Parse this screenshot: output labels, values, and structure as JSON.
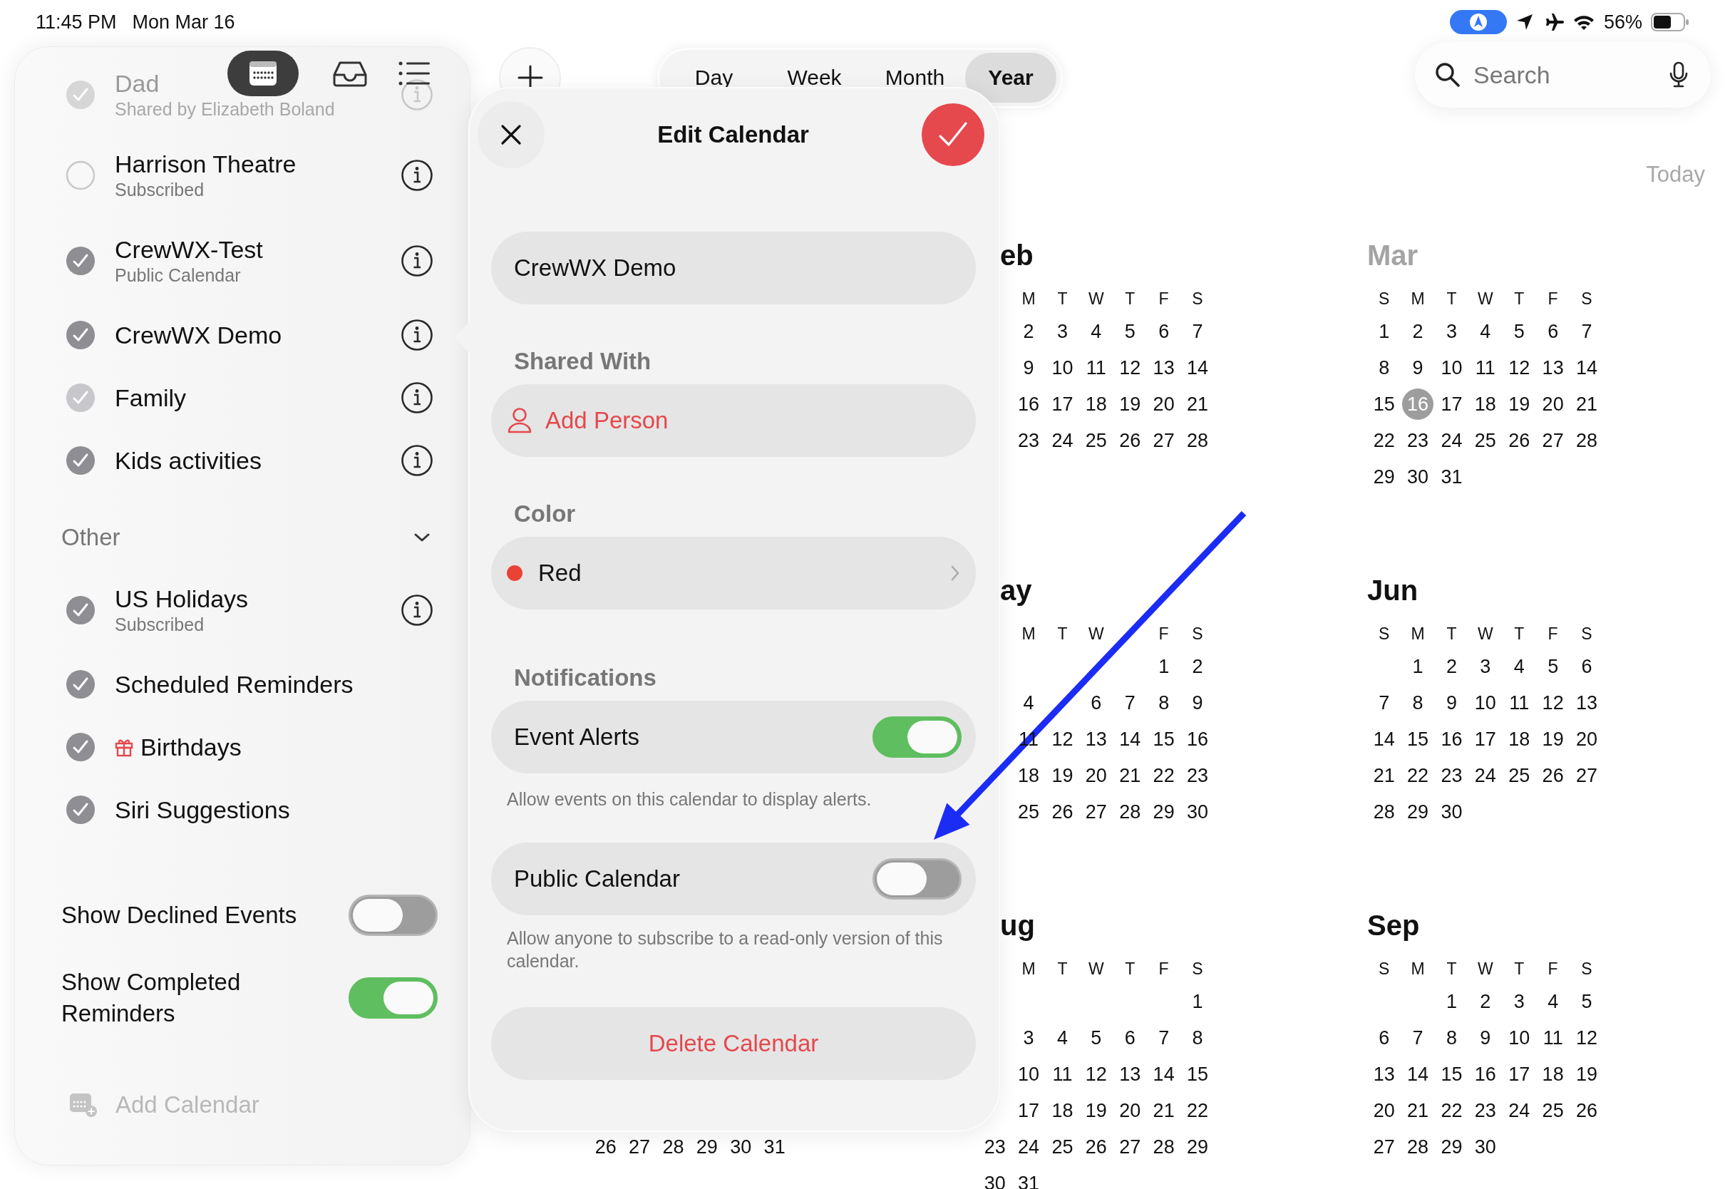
{
  "status_bar": {
    "time": "11:45 PM",
    "date": "Mon Mar 16",
    "battery": "56%"
  },
  "sidebar": {
    "toolbar": [
      {
        "kind": "calendar",
        "selected": true
      },
      {
        "kind": "inbox",
        "selected": false
      },
      {
        "kind": "list",
        "selected": false
      }
    ],
    "groups": [
      {
        "items": [
          {
            "title": "Dad",
            "subtitle": "Shared by Elizabeth Boland",
            "checked": true,
            "color": "#d6d6d6",
            "dimmed": true,
            "info": true,
            "kind": "calendar"
          },
          {
            "title": "Harrison Theatre",
            "subtitle": "Subscribed",
            "checked": false,
            "color": "#c7c7cc",
            "dimmed": false,
            "info": true,
            "kind": "calendar"
          },
          {
            "title": "CrewWX-Test",
            "subtitle": "Public Calendar",
            "checked": true,
            "color": "#8e8e93",
            "dimmed": false,
            "info": true,
            "kind": "calendar"
          },
          {
            "title": "CrewWX Demo",
            "checked": true,
            "color": "#8e8e93",
            "dimmed": false,
            "info": true,
            "kind": "calendar"
          },
          {
            "title": "Family",
            "checked": true,
            "color": "#c7c7cc",
            "dimmed": false,
            "info": true,
            "kind": "calendar"
          },
          {
            "title": "Kids activities",
            "checked": true,
            "color": "#8e8e93",
            "dimmed": false,
            "info": true,
            "kind": "calendar"
          }
        ]
      },
      {
        "header": "Other",
        "expanded": true,
        "items": [
          {
            "title": "US Holidays",
            "subtitle": "Subscribed",
            "checked": true,
            "color": "#8e8e93",
            "dimmed": false,
            "info": true,
            "kind": "calendar"
          },
          {
            "title": "Scheduled Reminders",
            "checked": true,
            "color": "#8e8e93",
            "dimmed": false,
            "info": false,
            "kind": "calendar"
          },
          {
            "title": "Birthdays",
            "checked": true,
            "color": "#8e8e93",
            "dimmed": false,
            "info": false,
            "kind": "birthday"
          },
          {
            "title": "Siri Suggestions",
            "checked": true,
            "color": "#8e8e93",
            "dimmed": false,
            "info": false,
            "kind": "calendar"
          }
        ]
      }
    ],
    "toggles": [
      {
        "label": "Show Declined Events",
        "on": false
      },
      {
        "label": "Show Completed Reminders",
        "on": true
      }
    ],
    "add_calendar": {
      "label": "Add Calendar",
      "disabled": true
    }
  },
  "view_switcher": [
    {
      "label": "Day",
      "selected": false
    },
    {
      "label": "Week",
      "selected": false
    },
    {
      "label": "Month",
      "selected": false
    },
    {
      "label": "Year",
      "selected": true
    }
  ],
  "search": {
    "placeholder": "Search"
  },
  "today_button": {
    "label": "Today",
    "disabled": true
  },
  "year_grid": {
    "rows": [
      [
        {
          "kind": "hidden"
        },
        {
          "kind": "month",
          "title": "eb",
          "current": false,
          "weekdays": {
            "mon": "M",
            "tue": "T",
            "wed": "W",
            "thu": "T",
            "fri": "F",
            "sat": "S"
          },
          "weeks": [
            {
              "mon": "2",
              "tue": "3",
              "wed": "4",
              "thu": "5",
              "fri": "6",
              "sat": "7"
            },
            {
              "mon": "9",
              "tue": "10",
              "wed": "11",
              "thu": "12",
              "fri": "13",
              "sat": "14"
            },
            {
              "mon": "16",
              "tue": "17",
              "wed": "18",
              "thu": "19",
              "fri": "20",
              "sat": "21"
            },
            {
              "mon": "23",
              "tue": "24",
              "wed": "25",
              "thu": "26",
              "fri": "27",
              "sat": "28"
            }
          ]
        },
        {
          "kind": "month",
          "title": "Mar",
          "current": true,
          "weekdays": {
            "sun": "S",
            "mon": "M",
            "tue": "T",
            "wed": "W",
            "thu": "T",
            "fri": "F",
            "sat": "S"
          },
          "weeks": [
            {
              "sun": "1",
              "mon": "2",
              "tue": "3",
              "wed": "4",
              "thu": "5",
              "fri": "6",
              "sat": "7"
            },
            {
              "sun": "8",
              "mon": "9",
              "tue": "10",
              "wed": "11",
              "thu": "12",
              "fri": "13",
              "sat": "14"
            },
            {
              "sun": "15",
              "mon": {
                "day": "16",
                "today": true
              },
              "tue": "17",
              "wed": "18",
              "thu": "19",
              "fri": "20",
              "sat": "21"
            },
            {
              "sun": "22",
              "mon": "23",
              "tue": "24",
              "wed": "25",
              "thu": "26",
              "fri": "27",
              "sat": "28"
            },
            {
              "sun": "29",
              "mon": "30",
              "tue": "31"
            }
          ]
        }
      ],
      [
        {
          "kind": "hidden"
        },
        {
          "kind": "month",
          "title": "ay",
          "current": false,
          "weekdays": {
            "mon": "M",
            "tue": "T",
            "wed": "W",
            "fri": "F",
            "sat": "S"
          },
          "weeks": [
            {
              "fri": "1",
              "sat": "2"
            },
            {
              "mon": "4",
              "wed": "6",
              "thu": "7",
              "fri": "8",
              "sat": "9"
            },
            {
              "mon": "11",
              "tue": "12",
              "wed": "13",
              "thu": "14",
              "fri": "15",
              "sat": "16"
            },
            {
              "mon": "18",
              "tue": "19",
              "wed": "20",
              "thu": "21",
              "fri": "22",
              "sat": "23"
            },
            {
              "mon": "25",
              "tue": "26",
              "wed": "27",
              "thu": "28",
              "fri": "29",
              "sat": "30"
            }
          ]
        },
        {
          "kind": "month",
          "title": "Jun",
          "current": false,
          "weekdays": {
            "sun": "S",
            "mon": "M",
            "tue": "T",
            "wed": "W",
            "thu": "T",
            "fri": "F",
            "sat": "S"
          },
          "weeks": [
            {
              "mon": "1",
              "tue": "2",
              "wed": "3",
              "thu": "4",
              "fri": "5",
              "sat": "6"
            },
            {
              "sun": "7",
              "mon": "8",
              "tue": "9",
              "wed": "10",
              "thu": "11",
              "fri": "12",
              "sat": "13"
            },
            {
              "sun": "14",
              "mon": "15",
              "tue": "16",
              "wed": "17",
              "thu": "18",
              "fri": "19",
              "sat": "20"
            },
            {
              "sun": "21",
              "mon": "22",
              "tue": "23",
              "wed": "24",
              "thu": "25",
              "fri": "26",
              "sat": "27"
            },
            {
              "sun": "28",
              "mon": "29",
              "tue": "30"
            }
          ]
        }
      ],
      [
        {
          "kind": "tail",
          "weeks": [
            {
              "sun": "26",
              "mon": "27",
              "tue": "28",
              "wed": "29",
              "thu": "30",
              "fri": "31"
            }
          ]
        },
        {
          "kind": "month",
          "title": "ug",
          "current": false,
          "weekdays": {
            "mon": "M",
            "tue": "T",
            "wed": "W",
            "thu": "T",
            "fri": "F",
            "sat": "S"
          },
          "weeks": [
            {
              "sat": "1"
            },
            {
              "mon": "3",
              "tue": "4",
              "wed": "5",
              "thu": "6",
              "fri": "7",
              "sat": "8"
            },
            {
              "mon": "10",
              "tue": "11",
              "wed": "12",
              "thu": "13",
              "fri": "14",
              "sat": "15"
            },
            {
              "mon": "17",
              "tue": "18",
              "wed": "19",
              "thu": "20",
              "fri": "21",
              "sat": "22"
            },
            {
              "sun": "23",
              "mon": "24",
              "tue": "25",
              "wed": "26",
              "thu": "27",
              "fri": "28",
              "sat": "29"
            },
            {
              "sun": "30",
              "mon": "31"
            }
          ]
        },
        {
          "kind": "month",
          "title": "Sep",
          "current": false,
          "weekdays": {
            "sun": "S",
            "mon": "M",
            "tue": "T",
            "wed": "W",
            "thu": "T",
            "fri": "F",
            "sat": "S"
          },
          "weeks": [
            {
              "tue": "1",
              "wed": "2",
              "thu": "3",
              "fri": "4",
              "sat": "5"
            },
            {
              "sun": "6",
              "mon": "7",
              "tue": "8",
              "wed": "9",
              "thu": "10",
              "fri": "11",
              "sat": "12"
            },
            {
              "sun": "13",
              "mon": "14",
              "tue": "15",
              "wed": "16",
              "thu": "17",
              "fri": "18",
              "sat": "19"
            },
            {
              "sun": "20",
              "mon": "21",
              "tue": "22",
              "wed": "23",
              "thu": "24",
              "fri": "25",
              "sat": "26"
            },
            {
              "sun": "27",
              "mon": "28",
              "tue": "29",
              "wed": "30"
            }
          ]
        }
      ]
    ]
  },
  "edit_calendar": {
    "title": "Edit Calendar",
    "name": "CrewWX Demo",
    "shared_with": {
      "label": "Shared With",
      "action": "Add Person"
    },
    "color": {
      "label": "Color",
      "value": "Red",
      "color": "#eb4236"
    },
    "notifications": {
      "label": "Notifications",
      "alerts": {
        "label": "Event Alerts",
        "on": true,
        "note": "Allow events on this calendar to display alerts."
      }
    },
    "public": {
      "label": "Public Calendar",
      "on": false,
      "note": "Allow anyone to subscribe to a read-only version of this calendar."
    },
    "delete": "Delete Calendar"
  },
  "annotation": {
    "kind": "arrow",
    "color": "#1b2cf5"
  }
}
